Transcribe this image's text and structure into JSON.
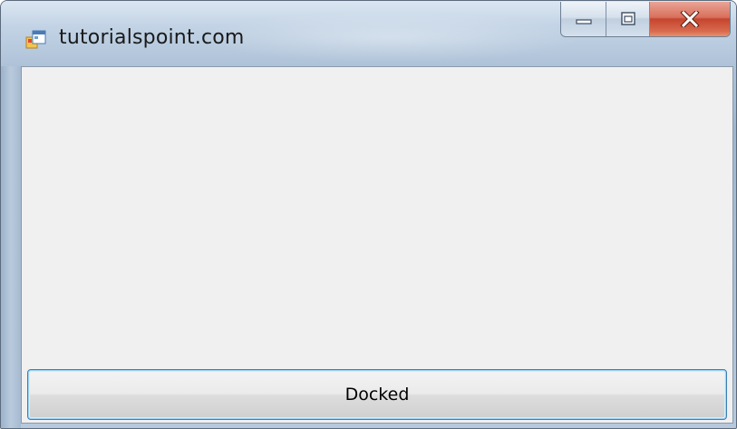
{
  "window": {
    "title": "tutorialspoint.com",
    "app_icon": "windows-form-icon",
    "caption_buttons": {
      "minimize_icon": "minimize-icon",
      "maximize_icon": "maximize-icon",
      "close_icon": "close-icon",
      "close_color": "#c5452e"
    }
  },
  "form": {
    "background_color": "#f0f0f0",
    "docked_button": {
      "label": "Docked",
      "dock": "bottom"
    }
  }
}
